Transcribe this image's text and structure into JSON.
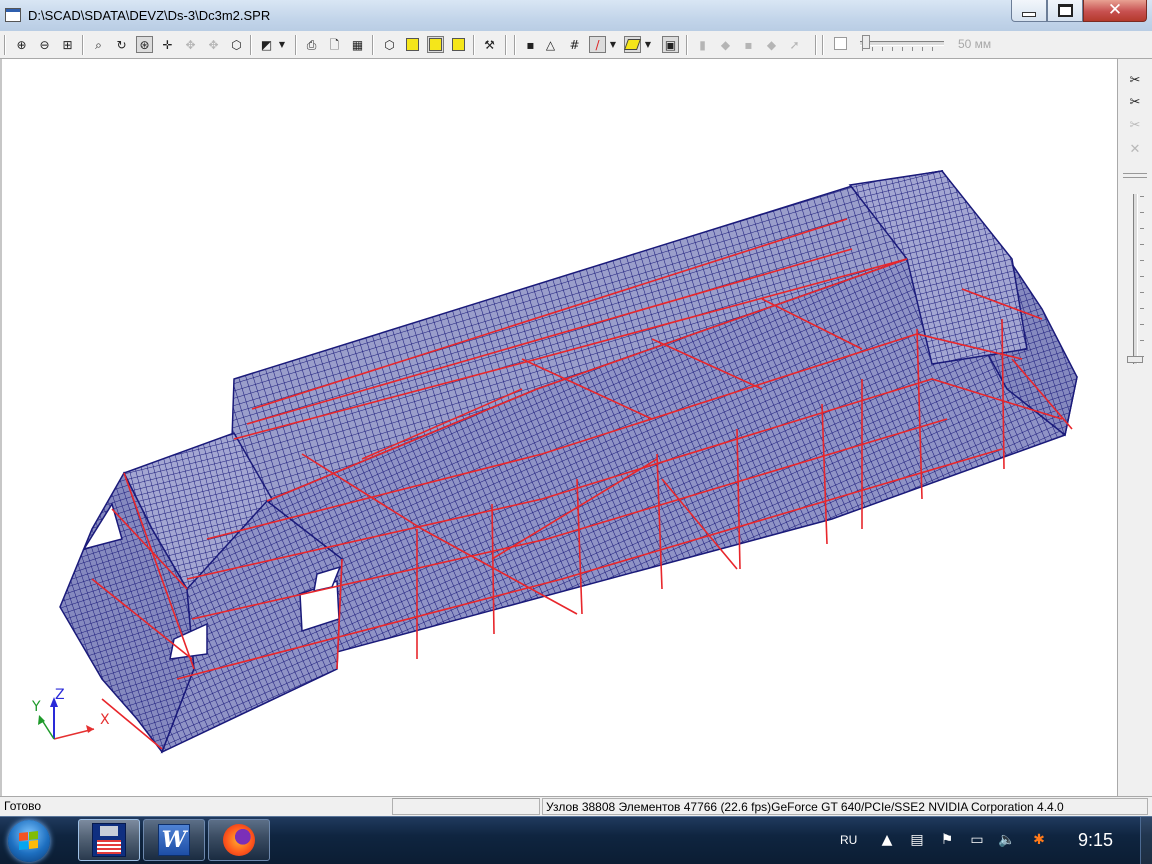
{
  "window": {
    "title": "D:\\SCAD\\SDATA\\DEVZ\\Ds-3\\Dc3m2.SPR",
    "minimize_glyph": "",
    "close_glyph": "✕"
  },
  "toolbar": {
    "unit_label": "50 мм",
    "icons": [
      "zoom-in-icon",
      "zoom-out-icon",
      "zoom-window-icon",
      "zoom-all-icon",
      "rotate-icon",
      "pan-icon",
      "move-icon",
      "rotate-free-icon",
      "perspective-icon",
      "box-view-icon",
      "print-icon",
      "preview-icon",
      "export-icon",
      "wireframe-icon",
      "shaded-icon",
      "solid-icon",
      "tools-icon",
      "node-icon",
      "element-icon",
      "grid-icon",
      "line-color-icon",
      "fill-color-icon",
      "frame-icon"
    ]
  },
  "right_panel": {
    "icons": [
      "cut-section-icon",
      "cut-plane-icon",
      "cut-off-icon",
      "cut-disabled-icon"
    ]
  },
  "axes": {
    "x": "X",
    "y": "Y",
    "z": "Z"
  },
  "statusbar": {
    "status": "Готово",
    "mid": "",
    "info": "Узлов 38808  Элементов 47766  (22.6 fps)GeForce GT 640/PCIe/SSE2 NVIDIA Corporation 4.4.0"
  },
  "taskbar": {
    "apps": [
      "SCAD",
      "Word",
      "Firefox"
    ],
    "word_letter": "W",
    "language": "RU",
    "clock": "9:15"
  },
  "colors": {
    "mesh": "#1a1a7a",
    "mesh_fill": "#8f93c6",
    "beams": "#e8262b",
    "viewport": "#ffffff",
    "axis_x": "#e53030",
    "axis_y": "#1f9a2b",
    "axis_z": "#2a2ad8"
  }
}
